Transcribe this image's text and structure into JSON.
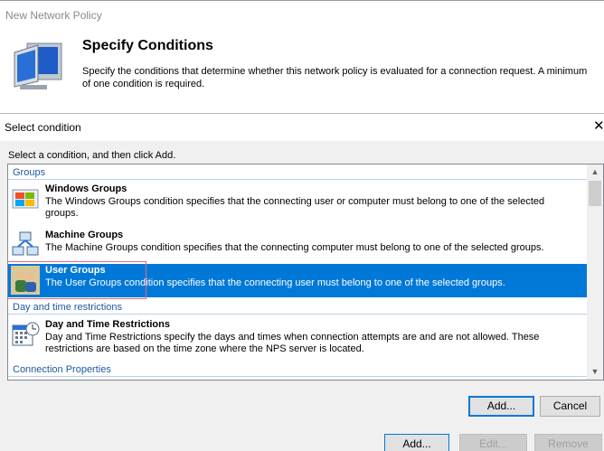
{
  "parent_window": {
    "title": "New Network Policy",
    "header_title": "Specify Conditions",
    "header_desc_line1": "Specify the conditions that determine whether this network policy is evaluated for a connection request. A minimum",
    "header_desc_line2": "of one condition is required."
  },
  "dialog": {
    "title": "Select condition",
    "close_glyph": "✕",
    "instruction": "Select a condition, and then click Add.",
    "groups": [
      {
        "header": "Groups",
        "items": [
          {
            "name": "Windows Groups",
            "desc": "The Windows Groups condition specifies that the connecting user or computer must belong to one of the selected groups.",
            "icon": "windows-groups-icon"
          },
          {
            "name": "Machine Groups",
            "desc": "The Machine Groups condition specifies that the connecting computer must belong to one of the selected groups.",
            "icon": "machine-groups-icon"
          },
          {
            "name": "User Groups",
            "desc": "The User Groups condition specifies that the connecting user must belong to one of the selected groups.",
            "icon": "user-groups-icon",
            "selected": true
          }
        ]
      },
      {
        "header": "Day and time restrictions",
        "items": [
          {
            "name": "Day and Time Restrictions",
            "desc": "Day and Time Restrictions specify the days and times when connection attempts are and are not allowed. These restrictions are based on the time zone where the NPS server is located.",
            "icon": "calendar-clock-icon"
          }
        ]
      },
      {
        "header": "Connection Properties",
        "items": []
      }
    ],
    "scroll_up": "▲",
    "scroll_down": "▼",
    "add_button": "Add...",
    "cancel_button": "Cancel"
  },
  "parent_buttons": {
    "add": "Add...",
    "edit": "Edit...",
    "remove": "Remove"
  },
  "colors": {
    "selection": "#0078d7",
    "group_header": "#1e5aa0",
    "selection_outline": "#e06c7c"
  }
}
